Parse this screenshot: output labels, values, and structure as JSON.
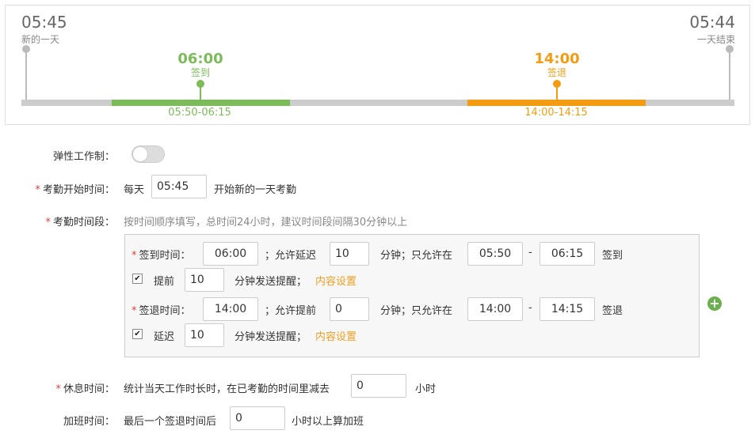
{
  "timeline": {
    "day_start_time": "05:45",
    "day_start_label": "新的一天",
    "day_end_time": "05:44",
    "day_end_label": "一天结束",
    "checkin_time": "06:00",
    "checkin_label": "签到",
    "checkin_range": "05:50-06:15",
    "checkout_time": "14:00",
    "checkout_label": "签退",
    "checkout_range": "14:00-14:15",
    "colors": {
      "checkin": "#7dbb5a",
      "checkout": "#f39c12",
      "track": "#cccccc"
    }
  },
  "form": {
    "flexible": {
      "label": "弹性工作制：",
      "enabled": false
    },
    "start_time": {
      "label": "考勤开始时间：",
      "prefix": "每天",
      "value": "05:45",
      "suffix": "开始新的一天考勤"
    },
    "periods": {
      "label": "考勤时间段：",
      "hint": "按时间顺序填写，总时间24小时，建议时间段间隔30分钟以上"
    },
    "checkin": {
      "label": "签到时间：",
      "value": "06:00",
      "allow_text": "；允许延迟",
      "allow_value": "10",
      "minutes_text": "分钟；只允许在",
      "from": "05:50",
      "dash": "-",
      "to": "06:15",
      "end_text": "签到",
      "remind_checked": true,
      "remind_prefix": "提前",
      "remind_value": "10",
      "remind_text": "分钟发送提醒；",
      "content_link": "内容设置"
    },
    "checkout": {
      "label": "签退时间：",
      "value": "14:00",
      "allow_text": "；允许提前",
      "allow_value": "0",
      "minutes_text": "分钟；只允许在",
      "from": "14:00",
      "dash": "-",
      "to": "14:15",
      "end_text": "签退",
      "remind_checked": true,
      "remind_prefix": "延迟",
      "remind_value": "10",
      "remind_text": "分钟发送提醒；",
      "content_link": "内容设置"
    },
    "add_icon": "plus-circle-icon",
    "rest": {
      "label": "休息时间：",
      "prefix": "统计当天工作时长时，在已考勤的时间里减去",
      "value": "0",
      "suffix": "小时"
    },
    "overtime": {
      "label": "加班时间：",
      "prefix": "最后一个签退时间后",
      "value": "0",
      "suffix": "小时以上算加班"
    }
  }
}
